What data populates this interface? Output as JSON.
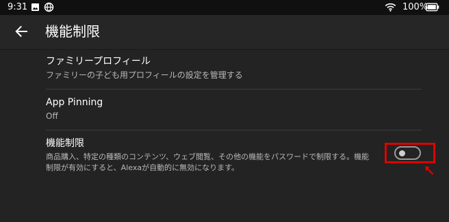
{
  "status_bar": {
    "time": "9:31",
    "battery_percent": "100%",
    "icons": [
      "gallery-icon",
      "globe-icon",
      "wifi-icon",
      "battery-icon"
    ]
  },
  "header": {
    "back_icon": "arrow-left-icon",
    "title": "機能制限"
  },
  "settings": [
    {
      "title": "ファミリープロフィール",
      "subtitle": "ファミリーの子ども用プロフィールの設定を管理する"
    },
    {
      "title": "App Pinning",
      "subtitle": "Off"
    },
    {
      "title": "機能制限",
      "description_lines": [
        "商品購入、特定の種類のコンテンツ、ウェブ閲覧、その他の機能をパスワードで制限する。機能",
        "制限が有効にすると、Alexaが自動的に無効になります。"
      ],
      "toggle_enabled": false
    }
  ],
  "annotation": {
    "highlight_color": "#e00000",
    "pointer_icon": "arrow-pointer-icon"
  },
  "colors": {
    "background": "#232323",
    "header_background": "#262626",
    "status_bar_background": "#101010",
    "secondary_text": "#b9b9b9",
    "divider": "#3c3c3c"
  }
}
